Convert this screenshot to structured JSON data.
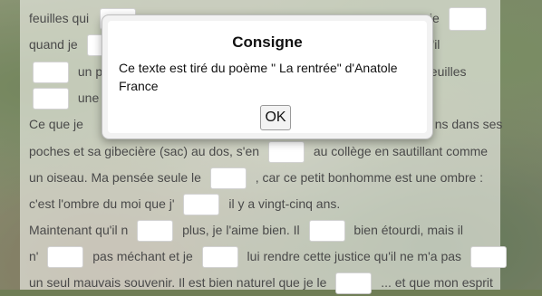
{
  "text": {
    "lines": [
      {
        "parts": [
          "feuilles qui",
          "",
          "je"
        ]
      },
      {
        "parts": [
          "quand je",
          "",
          "rs qu'il"
        ]
      },
      {
        "parts": [
          "",
          "un p",
          "feuilles"
        ]
      },
      {
        "parts": [
          "",
          "une a"
        ]
      },
      {
        "parts": [
          "Ce que je",
          "ns dans ses"
        ]
      },
      {
        "parts": [
          "poches et sa gibecière (sac) au dos, s'en",
          "au collège en sautillant comme"
        ]
      },
      {
        "parts": [
          "un oiseau. Ma pensée seule le",
          ", car ce petit bonhomme est une ombre :"
        ]
      },
      {
        "parts": [
          "c'est l'ombre du moi que j'",
          "il y a vingt-cinq ans."
        ]
      },
      {
        "parts": [
          "Maintenant qu'il n",
          "plus, je l'aime bien. Il",
          "bien étourdi, mais il"
        ]
      },
      {
        "parts": [
          "n'",
          "pas méchant et je",
          "lui rendre cette justice qu'il ne m'a pas"
        ]
      },
      {
        "parts": [
          "un seul mauvais souvenir. Il est bien naturel que je le",
          "... et que mon esprit"
        ]
      }
    ]
  },
  "dialog": {
    "title": "Consigne",
    "message": "Ce texte est tiré du poème \" La rentrée\" d'Anatole France",
    "ok_label": "OK"
  }
}
